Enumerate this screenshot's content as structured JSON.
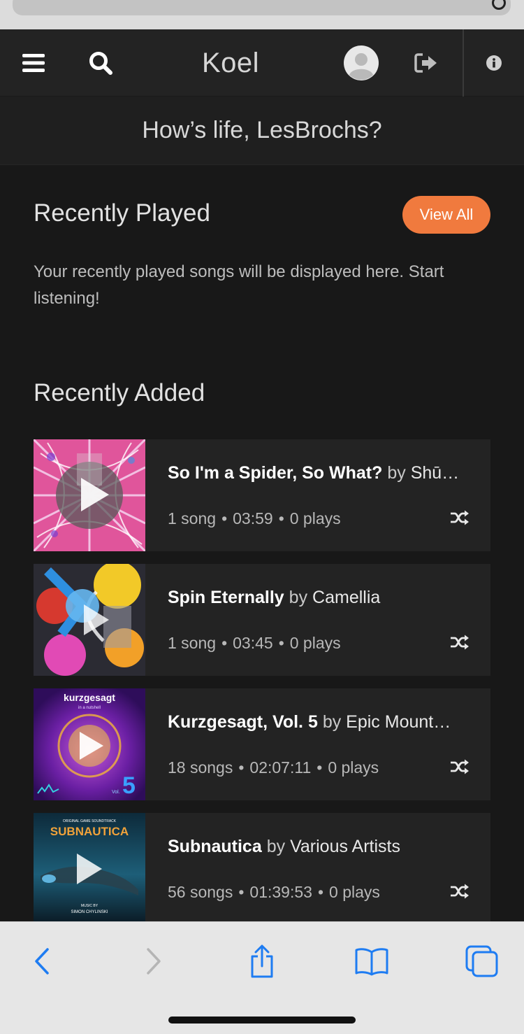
{
  "header": {
    "app_title": "Koel",
    "icons": [
      "menu-icon",
      "search-icon",
      "avatar-icon",
      "logout-icon",
      "info-icon"
    ]
  },
  "greeting": "How’s life, LesBrochs?",
  "recently_played": {
    "title": "Recently Played",
    "view_all_label": "View All",
    "empty_message": "Your recently played songs will be displayed here. Start listening!"
  },
  "recently_added": {
    "title": "Recently Added",
    "albums": [
      {
        "name": "So I'm a Spider, So What?",
        "by": "by",
        "artist": "Shū…",
        "songs": "1 song",
        "duration": "03:59",
        "plays": "0 plays"
      },
      {
        "name": "Spin Eternally",
        "by": "by",
        "artist": "Camellia",
        "songs": "1 song",
        "duration": "03:45",
        "plays": "0 plays"
      },
      {
        "name": "Kurzgesagt, Vol. 5",
        "by": "by",
        "artist": "Epic Mount…",
        "songs": "18 songs",
        "duration": "02:07:11",
        "plays": "0 plays",
        "cover_text": {
          "brand": "kurzgesagt",
          "tagline": "in a nutshell",
          "vol": "Vol.",
          "number": "5"
        }
      },
      {
        "name": "Subnautica",
        "by": "by",
        "artist": "Various Artists",
        "songs": "56 songs",
        "duration": "01:39:53",
        "plays": "0 plays",
        "cover_text": {
          "top": "ORIGINAL GAME SOUNDTRACK",
          "logo": "SUBNAUTICA",
          "music_by": "MUSIC BY",
          "composer": "SIMON CHYLINSKI"
        }
      }
    ]
  },
  "colors": {
    "accent": "#f07a3e",
    "background": "#181818",
    "card": "#232323",
    "safari_blue": "#1e7cf2"
  },
  "safari_toolbar": {
    "icons": [
      "back-icon",
      "forward-icon",
      "share-icon",
      "bookmarks-icon",
      "tabs-icon"
    ]
  }
}
